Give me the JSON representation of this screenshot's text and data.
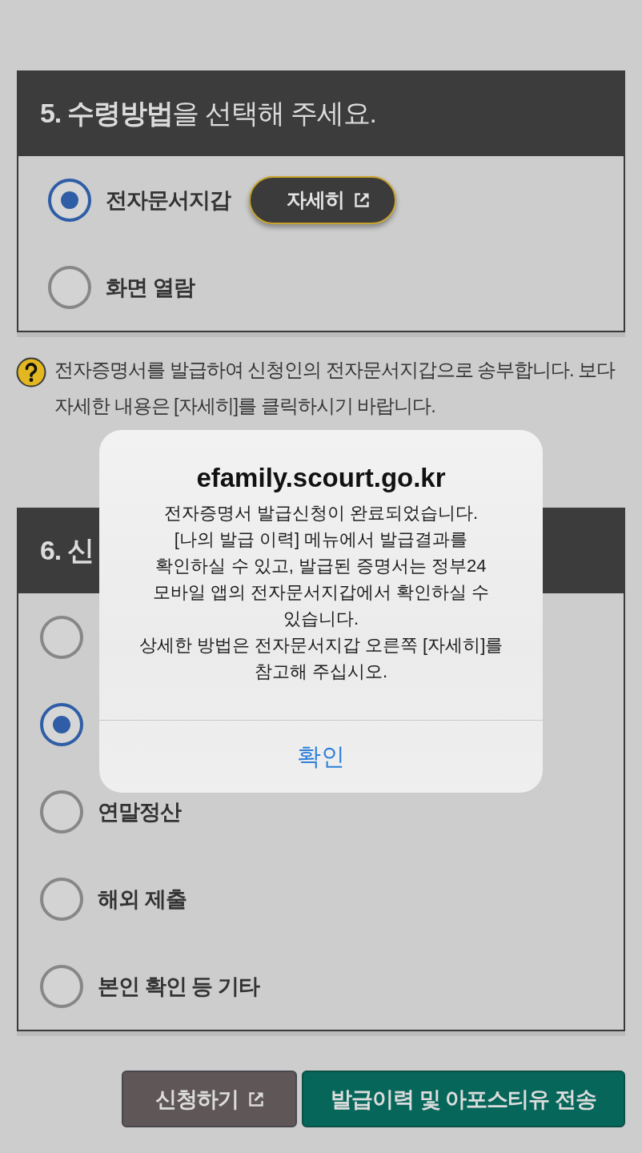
{
  "sections": [
    {
      "title": "**5. 수령방법**을 선택해 주세요.",
      "options": [
        {
          "label": "전자문서지갑",
          "selected": true,
          "detail_button": {
            "label": "자세히"
          }
        },
        {
          "label": "화면 열람",
          "selected": false
        }
      ]
    },
    {
      "title": "**6. 신**",
      "options": [
        {
          "selected": false
        },
        {
          "selected": true
        },
        {
          "label": "연말정산",
          "selected": false
        },
        {
          "label": "해외 제출",
          "selected": false
        },
        {
          "label": "본인 확인 등 기타",
          "selected": false
        }
      ]
    }
  ],
  "help": {
    "text": "전자증명서를 발급하여 신청인의 전자문서지갑으로 송부합니다. 보다 자세한 내용은 [자세히]를 클릭하시기 바랍니다."
  },
  "actions": [
    {
      "label": "신청하기",
      "kind": "external"
    },
    {
      "label": "발급이력 및 아포스티유 전송",
      "kind": "primary"
    }
  ],
  "dialog": {
    "title": "efamily.scourt.go.kr",
    "message": "전자증명서 발급신청이 완료되었습니다.\n[나의 발급 이력] 메뉴에서 발급결과를\n확인하실 수 있고, 발급된 증명서는 정부24\n모바일 앱의 전자문서지갑에서 확인하실 수\n있습니다.\n상세한 방법은 전자문서지갑 오른쪽 [자세히]를\n참고해 주십시오.",
    "buttons": [
      "확인"
    ]
  }
}
